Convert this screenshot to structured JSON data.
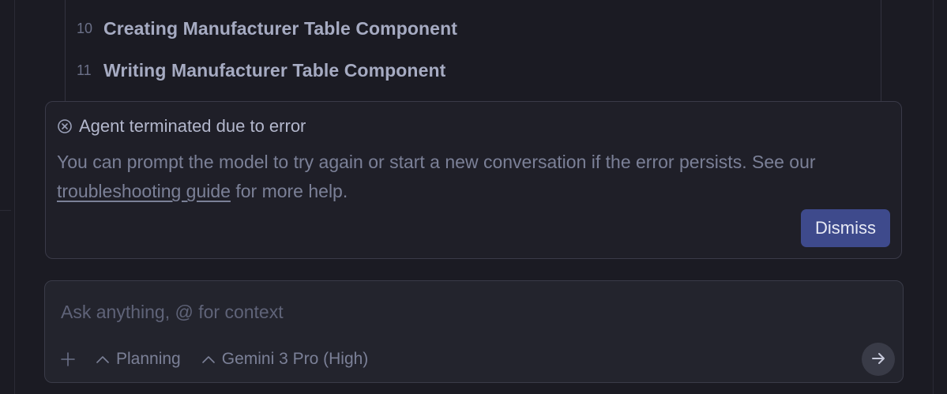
{
  "task_list": {
    "items": [
      {
        "number": "10",
        "label": "Creating Manufacturer Table Component"
      },
      {
        "number": "11",
        "label": "Writing Manufacturer Table Component"
      }
    ]
  },
  "error_card": {
    "icon": "x-circle-icon",
    "title": "Agent terminated due to error",
    "body_before_link": "You can prompt the model to try again or start a new conversation if the error persists. See our ",
    "link_text": "troubleshooting guide",
    "body_after_link": " for more help.",
    "dismiss_label": "Dismiss"
  },
  "chat_input": {
    "placeholder": "Ask anything, @ for context",
    "value": ""
  },
  "toolbar": {
    "add_icon": "plus-icon",
    "mode_label": "Planning",
    "model_label": "Gemini 3 Pro (High)",
    "send_icon": "arrow-right-icon"
  },
  "colors": {
    "background": "#1b1b23",
    "card_background": "#1f1f28",
    "accent": "#3e4a8c",
    "text_muted": "#7b8097"
  }
}
